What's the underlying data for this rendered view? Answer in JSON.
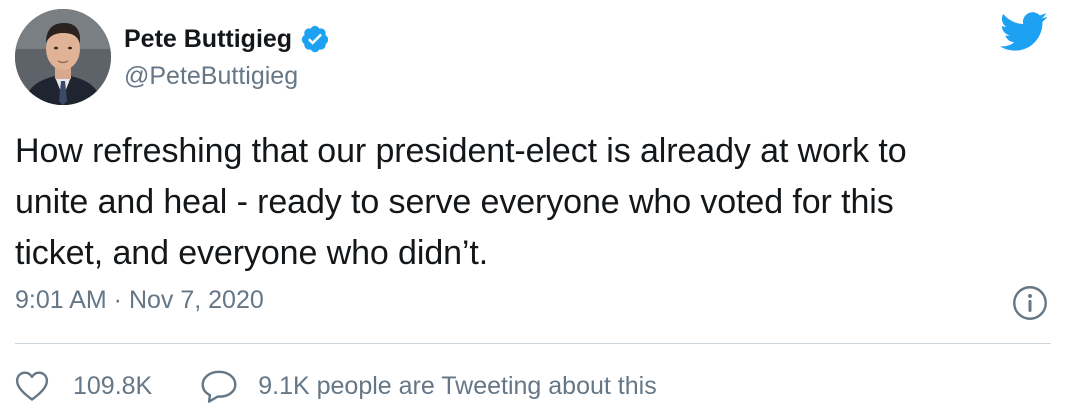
{
  "user": {
    "name": "Pete Buttigieg",
    "handle": "@PeteButtigieg"
  },
  "icons": {
    "verified": "verified-badge-icon",
    "brand": "twitter-bird-icon",
    "info": "info-icon",
    "like": "heart-icon",
    "reply": "comment-bubble-icon"
  },
  "colors": {
    "brand": "#1da1f2",
    "text": "#14171a",
    "muted": "#657786"
  },
  "tweet": {
    "text_lines": [
      "How refreshing that our president-elect is already at work to",
      "unite and heal - ready to serve everyone who voted for this",
      "ticket, and everyone who didn’t."
    ],
    "time": "9:01 AM",
    "separator": " · ",
    "date": "Nov 7, 2020"
  },
  "engagement": {
    "likes": "109.8K",
    "tweeting": "9.1K people are Tweeting about this"
  }
}
